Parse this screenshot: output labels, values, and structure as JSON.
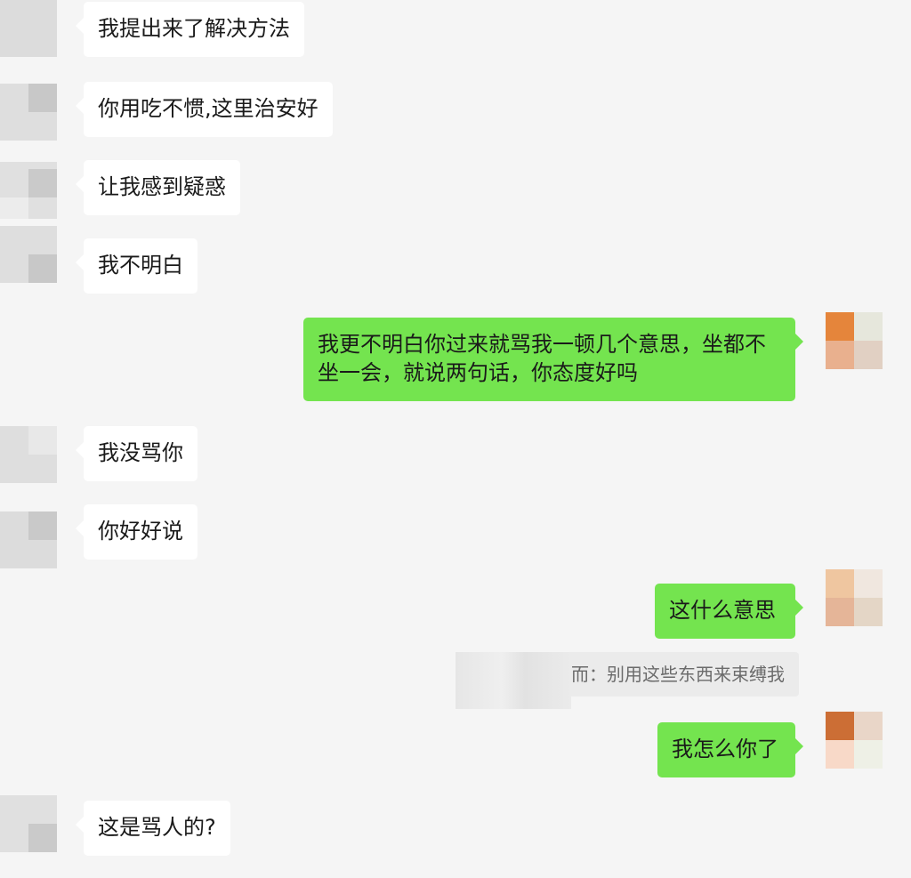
{
  "messages": [
    {
      "side": "in",
      "text": "我提出来了解决方法"
    },
    {
      "side": "in",
      "text": "你用吃不惯,这里治安好"
    },
    {
      "side": "in",
      "text": "让我感到疑惑"
    },
    {
      "side": "in",
      "text": "我不明白"
    },
    {
      "side": "out",
      "text": "我更不明白你过来就骂我一顿几个意思，坐都不坐一会，就说两句话，你态度好吗"
    },
    {
      "side": "in",
      "text": "我没骂你"
    },
    {
      "side": "in",
      "text": "你好好说"
    },
    {
      "side": "out",
      "text": "这什么意思"
    },
    {
      "side": "quote",
      "text": "而：别用这些东西来束缚我"
    },
    {
      "side": "out",
      "text": "我怎么你了"
    },
    {
      "side": "in",
      "text": "这是骂人的?"
    }
  ],
  "colors": {
    "background": "#f5f5f5",
    "incoming_bubble": "#ffffff",
    "outgoing_bubble": "#74e44f",
    "quote_bg": "#ebebeb"
  },
  "avatars": {
    "incoming": "contact-avatar-pixelated",
    "outgoing": "self-avatar-pixelated"
  }
}
